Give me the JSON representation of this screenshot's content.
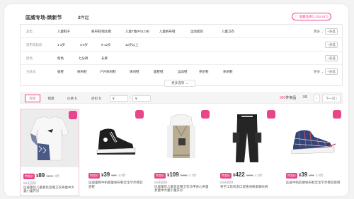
{
  "header": {
    "title": "匡威专场-焕新节",
    "count_num": "2",
    "count_unit": "件起",
    "favorite_label": "收藏品牌(1,252,817)"
  },
  "filters": [
    {
      "label": "品类",
      "options": [
        "儿童鞋子",
        "帆布鞋/硫化鞋",
        "儿童T恤/POLO衫",
        "儿童帆布鞋",
        "运动套装",
        "儿童卫衣"
      ],
      "more": "更多",
      "multi": "多选"
    },
    {
      "label": "适用年龄段",
      "options": [
        "1-3岁",
        "3-6岁",
        "6-12岁",
        "12岁以上"
      ],
      "multi": "多选"
    },
    {
      "label": "颜色",
      "options": [
        "粉色",
        "七分裤",
        "长裤"
      ],
      "multi": "多选"
    },
    {
      "label": "主款式",
      "options": [
        "板鞋",
        "帆布鞋",
        "户外休闲鞋",
        "休闲鞋",
        "面鞋鞋",
        "运动鞋",
        "英伦鞋",
        "休闲鞋"
      ],
      "more": "更多",
      "multi": "多选"
    }
  ],
  "more_filters_label": "更多选项",
  "sortbar": {
    "default": "综合",
    "sales": "销量",
    "price": "价格",
    "discount": "折扣",
    "price_min": "¥",
    "price_max": "¥",
    "result_count": "990",
    "result_suffix": "件商品",
    "page_current": "1",
    "page_total": "/5",
    "next_label": "下一页"
  },
  "products": [
    {
      "badge": "特卖价",
      "currency": "¥",
      "price": "89",
      "orig": "¥299",
      "sold": "3折",
      "line1": "93天良好",
      "line2": "匡威童装儿童春装连帽卫衣男童中大童小童开衫"
    },
    {
      "badge": "特卖价",
      "currency": "¥",
      "price": "39",
      "orig": "¥99",
      "sold": "4.0折",
      "line1": "",
      "line2": "匡威童鞋中帆婴童帆布鞋宝宝学步鞋软底鞋"
    },
    {
      "badge": "特卖价",
      "currency": "¥",
      "price": "109",
      "orig": "¥399",
      "sold": "2.7折",
      "line1": "93天良好",
      "line2": "匡威童装儿童装连帽卫衣马甲背心男童女童中大童小童开衫"
    },
    {
      "badge": "特卖价",
      "currency": "¥",
      "price": "422",
      "orig": "¥999",
      "sold": "4.2折",
      "line1": "93天良好",
      "line2": "男子工装风多口袋休闲裤束脚长裤"
    },
    {
      "badge": "特卖价",
      "currency": "¥",
      "price": "39",
      "orig": "¥99",
      "sold": "4.0折",
      "line1": "",
      "line2": "匡威中帆软硬帆布鞋宝宝学步鞋软底鞋"
    }
  ],
  "colors": {
    "accent": "#e8458b",
    "border": "#e6e6e6"
  }
}
